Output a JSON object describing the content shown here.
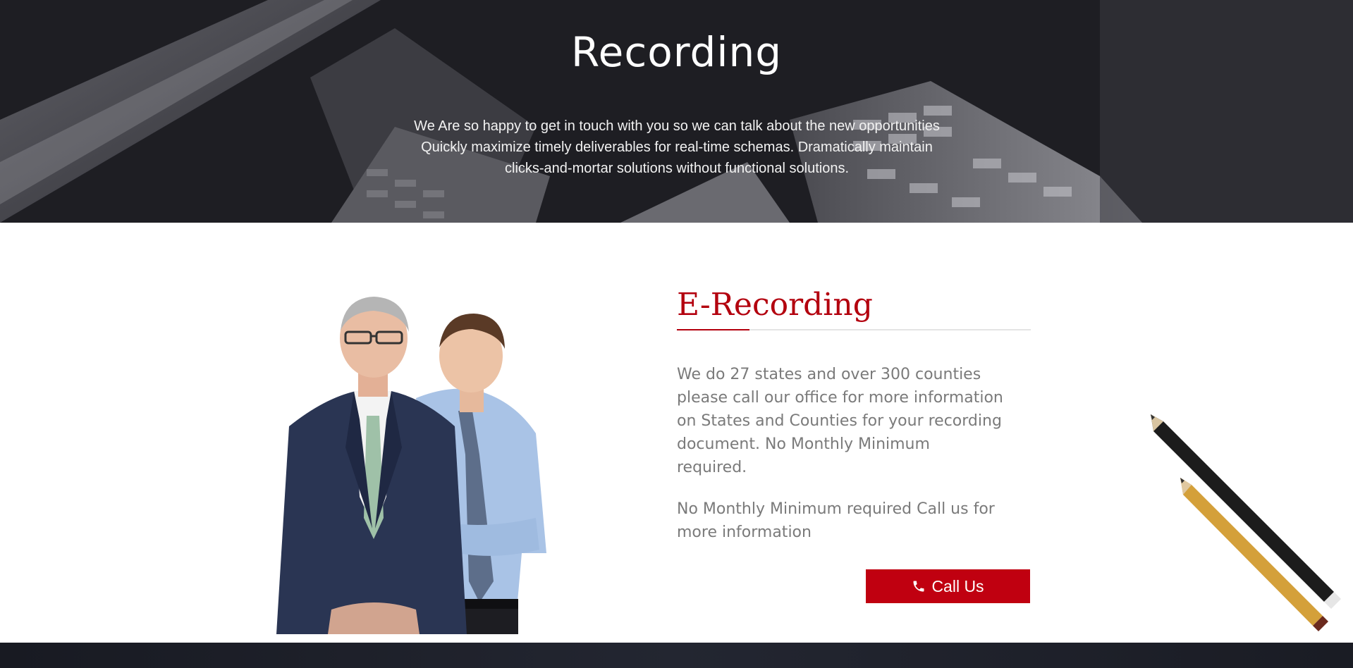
{
  "hero": {
    "title": "Recording",
    "text_lines": [
      "We Are so happy to get in touch with you so we can talk about the new opportunities",
      "Quickly maximize timely deliverables for real-time schemas. Dramatically maintain",
      "clicks-and-mortar solutions without functional solutions."
    ]
  },
  "section": {
    "title": "E-Recording",
    "paragraph1_lines": [
      "We do 27 states and over 300 counties",
      "please call our office for more information",
      "on States and Counties for your recording",
      "document. No Monthly Minimum",
      "required."
    ],
    "paragraph2_lines": [
      "No Monthly Minimum required Call us for",
      "more information"
    ],
    "button_label": "Call Us",
    "button_icon": "phone-icon"
  },
  "colors": {
    "accent": "#b3000e",
    "button": "#c00010",
    "body_text": "#7a7a7a"
  }
}
